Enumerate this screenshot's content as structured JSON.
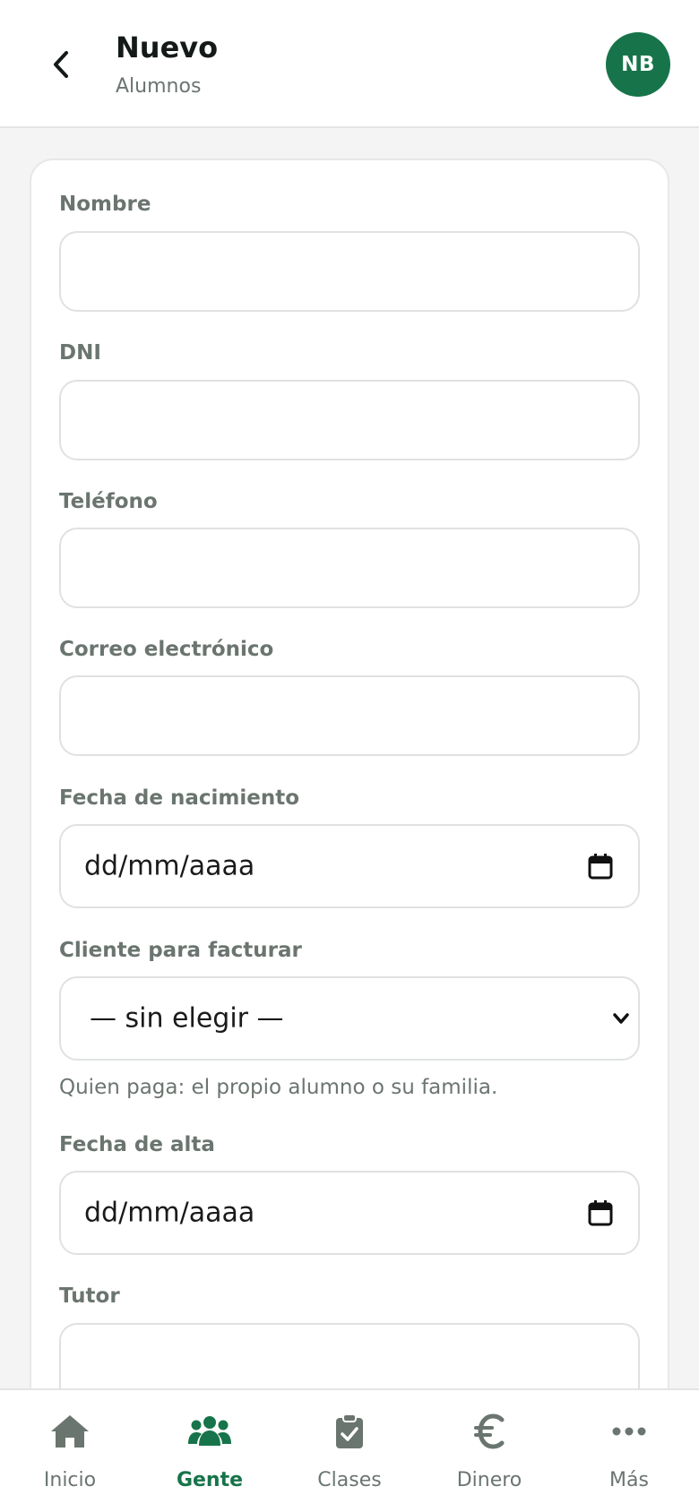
{
  "header": {
    "title": "Nuevo",
    "subtitle": "Alumnos",
    "avatar_initials": "NB"
  },
  "form": {
    "fields": [
      {
        "label": "Nombre",
        "value": ""
      },
      {
        "label": "DNI",
        "value": ""
      },
      {
        "label": "Teléfono",
        "value": ""
      },
      {
        "label": "Correo electrónico",
        "value": ""
      },
      {
        "label": "Fecha de nacimiento",
        "value": "dd/mm/aaaa"
      },
      {
        "label": "Cliente para facturar",
        "value": "— sin elegir —",
        "help": "Quien paga: el propio alumno o su familia."
      },
      {
        "label": "Fecha de alta",
        "value": "dd/mm/aaaa"
      },
      {
        "label": "Tutor",
        "value": ""
      }
    ]
  },
  "nav": {
    "items": [
      {
        "label": "Inicio",
        "icon": "home-icon"
      },
      {
        "label": "Gente",
        "icon": "people-icon",
        "active": true
      },
      {
        "label": "Clases",
        "icon": "clipboard-check-icon"
      },
      {
        "label": "Dinero",
        "icon": "euro-icon"
      },
      {
        "label": "Más",
        "icon": "more-icon"
      }
    ]
  },
  "colors": {
    "brand": "#17744a",
    "muted": "#6b756f",
    "background": "#f3f4f3"
  }
}
